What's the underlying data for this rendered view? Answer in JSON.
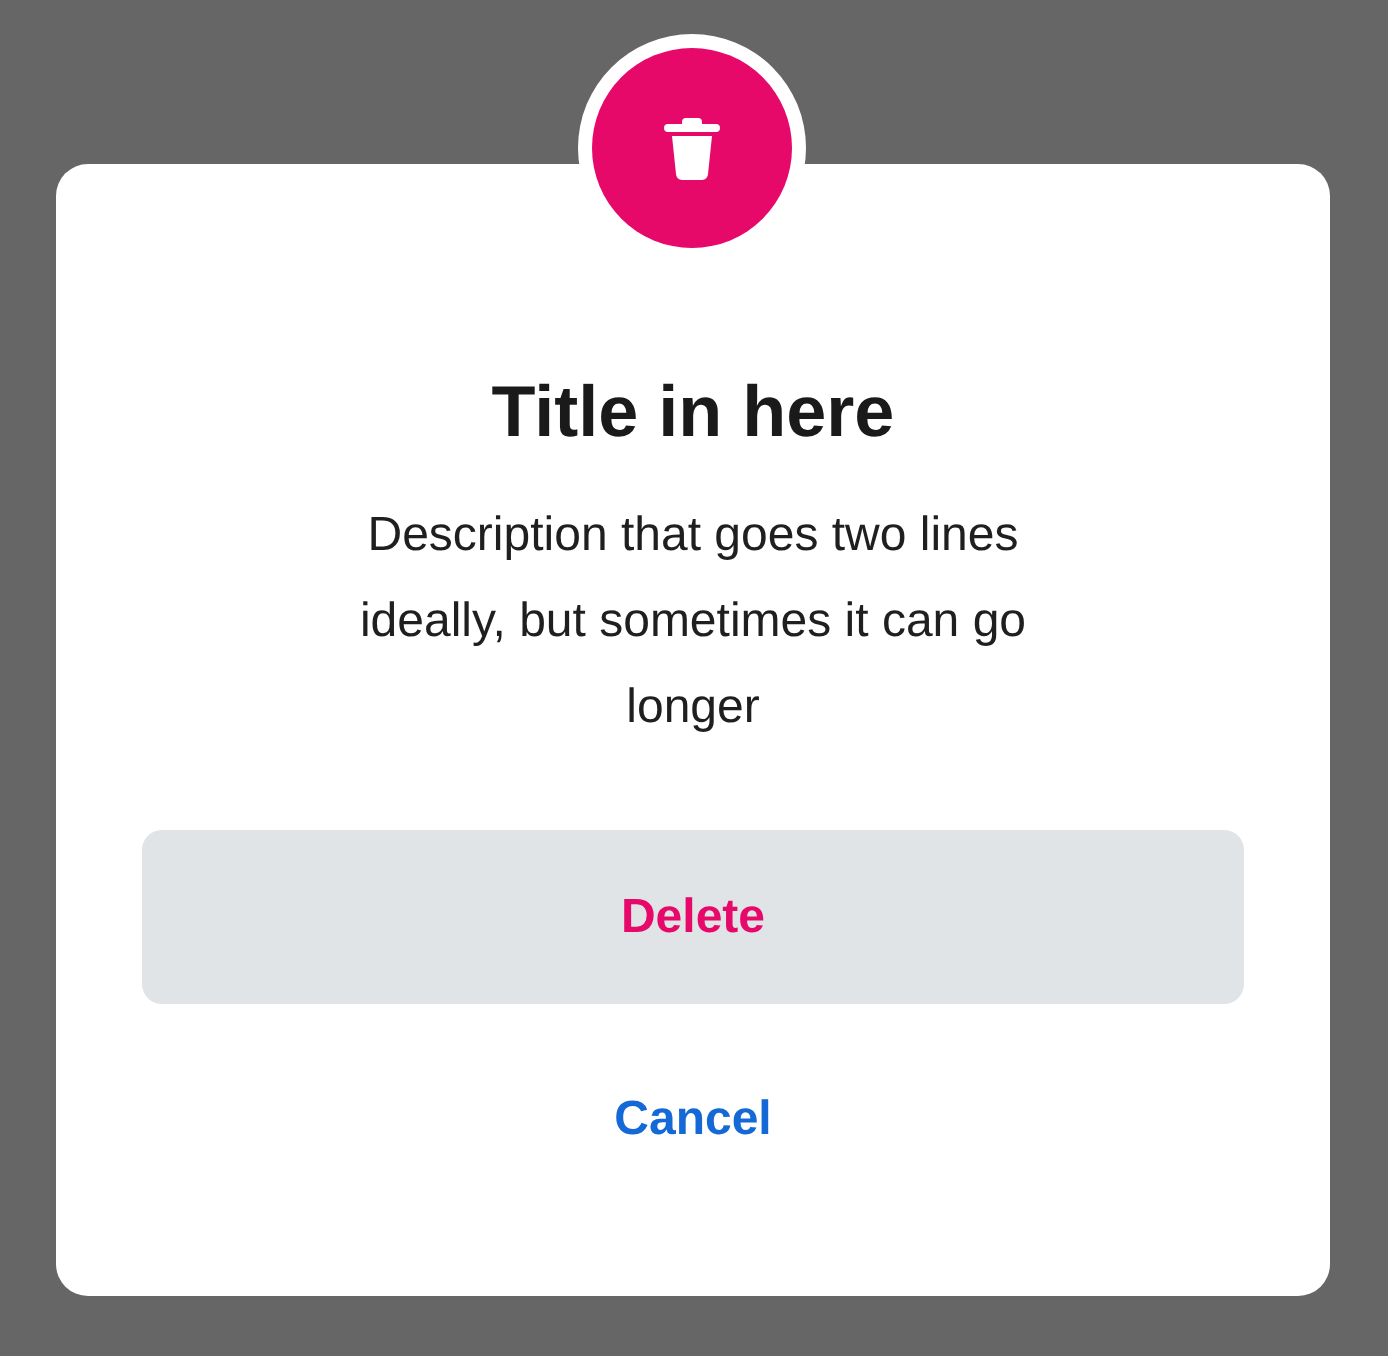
{
  "dialog": {
    "title": "Title in here",
    "description": "Description that goes two lines ideally, but sometimes it can go longer",
    "actions": [
      {
        "label": "Delete",
        "kind": "destructive"
      },
      {
        "label": "Cancel",
        "kind": "cancel"
      }
    ]
  }
}
